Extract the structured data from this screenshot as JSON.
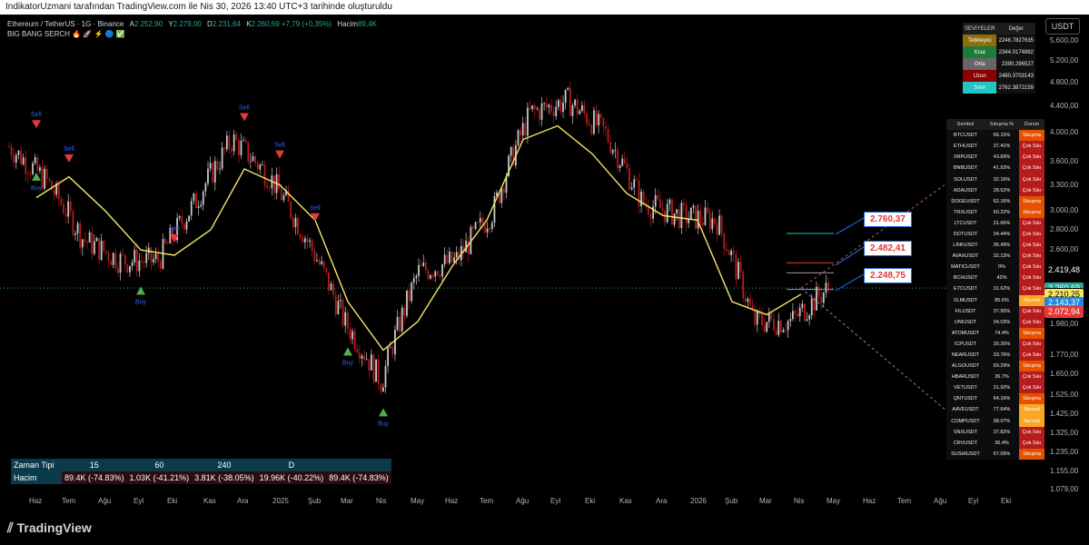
{
  "header": {
    "title": "IndikatorUzmani tarafından TradingView.com ile Nis 30, 2026 13:40 UTC+3 tarihinde oluşturuldu"
  },
  "legend": {
    "symbol": "Ethereum / TetherUS · 1G · Binance",
    "open_label": "A",
    "open": "2.252,90",
    "high_label": "Y",
    "high": "2.279,00",
    "low_label": "D",
    "low": "2.231,64",
    "close_label": "K",
    "close": "2.260,69",
    "change": "+7,79 (+0,35%)",
    "volume_label": "Hacim",
    "volume": "89,4K",
    "indicator": "BIG BANG SERCH 🔥 🚀 ⚡ 🔵 ✅"
  },
  "currency": "USDT",
  "levels_table": {
    "headers": [
      "SEVİYELER",
      "Değer"
    ],
    "rows": [
      {
        "name": "Tetikleyici",
        "value": "2248.7827635",
        "color": "#8d6e0e"
      },
      {
        "name": "Kısa",
        "value": "2344.0174882",
        "color": "#1e7b3a"
      },
      {
        "name": "Orta",
        "value": "2390.296527",
        "color": "#666666"
      },
      {
        "name": "Uzun",
        "value": "2480.3703143",
        "color": "#8b0000"
      },
      {
        "name": "Sınır",
        "value": "2762.3872159",
        "color": "#22c5c5"
      }
    ]
  },
  "scanner": {
    "headers": [
      "Sembol",
      "Sıkışma %",
      "Durum"
    ],
    "rows": [
      {
        "s": "BTCUSDT",
        "p": "66.15%",
        "d": "Sıkışma"
      },
      {
        "s": "ETHUSDT",
        "p": "37.41%",
        "d": "Çok Sıkı"
      },
      {
        "s": "XRPUSDT",
        "p": "43.69%",
        "d": "Çok Sıkı"
      },
      {
        "s": "BNBUSDT",
        "p": "41.93%",
        "d": "Çok Sıkı"
      },
      {
        "s": "SOLUSDT",
        "p": "32.16%",
        "d": "Çok Sıkı"
      },
      {
        "s": "ADAUSDT",
        "p": "28.52%",
        "d": "Çok Sıkı"
      },
      {
        "s": "DOGEUSDT",
        "p": "62.16%",
        "d": "Sıkışma"
      },
      {
        "s": "TRXUSDT",
        "p": "60.22%",
        "d": "Sıkışma"
      },
      {
        "s": "LTCUSDT",
        "p": "31.66%",
        "d": "Çok Sıkı"
      },
      {
        "s": "DOTUSDT",
        "p": "34.44%",
        "d": "Çok Sıkı"
      },
      {
        "s": "LINKUSDT",
        "p": "36.49%",
        "d": "Çok Sıkı"
      },
      {
        "s": "AVAXUSDT",
        "p": "32.13%",
        "d": "Çok Sıkı"
      },
      {
        "s": "MATICUSDT",
        "p": "0%",
        "d": "Çok Sıkı"
      },
      {
        "s": "BCHUSDT",
        "p": "42%",
        "d": "Çok Sıkı"
      },
      {
        "s": "ETCUSDT",
        "p": "31.62%",
        "d": "Çok Sıkı"
      },
      {
        "s": "XLMUSDT",
        "p": "85.6%",
        "d": "Normal"
      },
      {
        "s": "FILUSDT",
        "p": "37.95%",
        "d": "Çok Sıkı"
      },
      {
        "s": "UNIUSDT",
        "p": "34.03%",
        "d": "Çok Sıkı"
      },
      {
        "s": "ATOMUSDT",
        "p": "74.4%",
        "d": "Sıkışma"
      },
      {
        "s": "ICPUSDT",
        "p": "30.26%",
        "d": "Çok Sıkı"
      },
      {
        "s": "NEARUSDT",
        "p": "33.76%",
        "d": "Çok Sıkı"
      },
      {
        "s": "ALGOUSDT",
        "p": "69.29%",
        "d": "Sıkışma"
      },
      {
        "s": "HBARUSDT",
        "p": "36.7%",
        "d": "Çok Sıkı"
      },
      {
        "s": "VETUSDT",
        "p": "31.92%",
        "d": "Çok Sıkı"
      },
      {
        "s": "QNTUSDT",
        "p": "64.16%",
        "d": "Sıkışma"
      },
      {
        "s": "AAVEUSDT",
        "p": "77.64%",
        "d": "Normal"
      },
      {
        "s": "COMPUSDT",
        "p": "98.07%",
        "d": "Normal"
      },
      {
        "s": "SNXUSDT",
        "p": "37.82%",
        "d": "Çok Sıkı"
      },
      {
        "s": "CRVUSDT",
        "p": "36.4%",
        "d": "Çok Sıkı"
      },
      {
        "s": "SUSHIUSDT",
        "p": "67.09%",
        "d": "Sıkışma"
      }
    ]
  },
  "volume_table": {
    "r1": [
      "Zaman Tipi",
      "15",
      "60",
      "240",
      "D"
    ],
    "r2": [
      "Hacim",
      "89.4K (-74.83%)",
      "1.03K (-41.21%)",
      "3.81K (-38.05%)",
      "19.96K (-40.22%)",
      "89.4K (-74.83%)"
    ]
  },
  "callouts": [
    "2.760,37",
    "2.482,41",
    "2.248,75"
  ],
  "price_tags": [
    {
      "text": "2.419,48",
      "bg": "#000000",
      "fg": "#ffffff"
    },
    {
      "text": "2.260,69",
      "bg": "#26a69a",
      "fg": "#ffffff"
    },
    {
      "text": "2.217,04",
      "bg": "#000000",
      "fg": "#ffffff"
    },
    {
      "text": "2.210,25",
      "bg": "#f5e663",
      "fg": "#000000"
    },
    {
      "text": "2.143,37",
      "bg": "#1e88e5",
      "fg": "#ffffff"
    },
    {
      "text": "2.072,94",
      "bg": "#e53935",
      "fg": "#ffffff"
    }
  ],
  "signal_labels": {
    "buy": "Buy",
    "sell": "Sell"
  },
  "footer": {
    "brand": "TradingView"
  },
  "chart_data": {
    "type": "line",
    "title": "Ethereum / TetherUS · 1G · Binance",
    "y_scale": "log",
    "ylim": [
      1079,
      5600
    ],
    "y_ticks": [
      "5.600,00",
      "5.200,00",
      "4.800,00",
      "4.400,00",
      "4.000,00",
      "3.600,00",
      "3.300,00",
      "3.000,00",
      "2.800,00",
      "2.600,00",
      "2.419,48",
      "2.217,04",
      "1.980,00",
      "1.770,00",
      "1.650,00",
      "1.525,00",
      "1.425,00",
      "1.325,00",
      "1.235,00",
      "1.155,00",
      "1.079,00"
    ],
    "x_ticks": [
      "Haz",
      "Tem",
      "Ağu",
      "Eyl",
      "Eki",
      "Kas",
      "Ara",
      "2025",
      "Şub",
      "Mar",
      "Nis",
      "May",
      "Haz",
      "Tem",
      "Ağu",
      "Eyl",
      "Eki",
      "Kas",
      "Ara",
      "2026",
      "Şub",
      "Mar",
      "Nis",
      "May",
      "Haz",
      "Tem",
      "Ağu",
      "Eyl",
      "Eki"
    ],
    "x_label_positions": [
      40,
      76,
      116,
      155,
      192,
      232,
      269,
      308,
      347,
      383,
      422,
      460,
      498,
      536,
      576,
      614,
      652,
      690,
      730,
      768,
      806,
      844,
      882,
      918,
      958,
      996,
      1036,
      1074,
      1110
    ],
    "series": [
      {
        "name": "ETHUSDT",
        "x": [
          "Haz",
          "Tem",
          "Ağu",
          "Eyl",
          "Eki",
          "Kas",
          "Ara",
          "2025",
          "Şub",
          "Mar",
          "Nis",
          "May",
          "Haz",
          "Tem",
          "Ağu",
          "Eyl",
          "Eki",
          "Kas",
          "Ara",
          "2026",
          "Şub",
          "Mar",
          "Nis"
        ],
        "values": [
          3800,
          3350,
          2700,
          2500,
          2500,
          3100,
          3900,
          3400,
          2700,
          2000,
          1600,
          2400,
          2500,
          3000,
          4300,
          4500,
          4000,
          3100,
          2950,
          2900,
          2000,
          2000,
          2260
        ]
      },
      {
        "name": "BIG BANG SERCH",
        "x": [
          "Haz",
          "Tem",
          "Ağu",
          "Eyl",
          "Eki",
          "Kas",
          "Ara",
          "2025",
          "Şub",
          "Mar",
          "Nis",
          "May",
          "Haz",
          "Tem",
          "Ağu",
          "Eyl",
          "Eki",
          "Kas",
          "Ara",
          "2026",
          "Şub",
          "Mar",
          "Nis"
        ],
        "values": [
          3150,
          3400,
          3000,
          2600,
          2550,
          2800,
          3500,
          3300,
          2900,
          2150,
          1800,
          2000,
          2450,
          2900,
          3900,
          4100,
          3700,
          3200,
          2950,
          2900,
          2150,
          2050,
          2210
        ]
      }
    ],
    "signals": [
      {
        "type": "buy",
        "x": "Haz"
      },
      {
        "type": "sell",
        "x": "Tem"
      },
      {
        "type": "buy",
        "x": "Eyl"
      },
      {
        "type": "sell",
        "x": "Ara"
      },
      {
        "type": "sell",
        "x": "2025"
      },
      {
        "type": "sell",
        "x": "Şub"
      },
      {
        "type": "sell",
        "x": "Haz"
      },
      {
        "type": "sell",
        "x": "Eki"
      },
      {
        "type": "buy",
        "x": "Mar"
      },
      {
        "type": "buy",
        "x": "Nis"
      }
    ],
    "grid": false
  }
}
